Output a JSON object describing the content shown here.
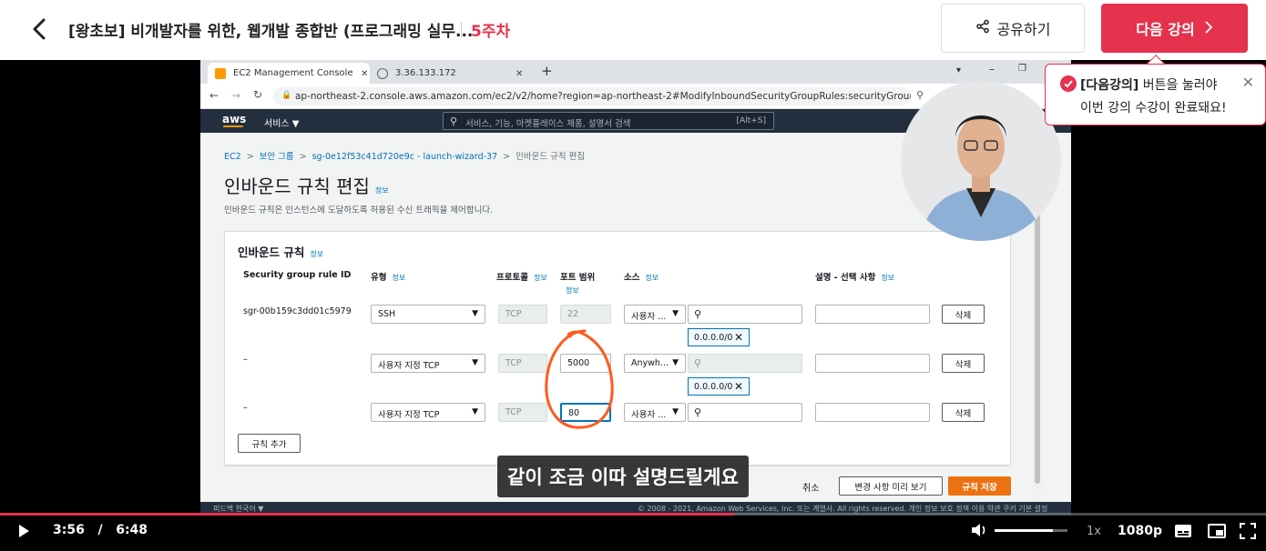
{
  "header": {
    "course_title": "[왕초보] 비개발자를 위한, 웹개발 종합반 (프로그래밍 실무...",
    "week": "5주차",
    "share_label": "공유하기",
    "next_label": "다음 강의"
  },
  "tooltip": {
    "highlight": "[다음강의]",
    "line1_rest": " 버튼을 눌러야",
    "line2": "이번 강의 수강이 완료돼요!"
  },
  "browser": {
    "tabs": [
      {
        "title": "EC2 Management Console"
      },
      {
        "title": "3.36.133.172"
      }
    ],
    "url": "ap-northeast-2.console.aws.amazon.com/ec2/v2/home?region=ap-northeast-2#ModifyInboundSecurityGroupRules:securityGroupId=sg-0e1..."
  },
  "aws": {
    "logo": "aws",
    "services": "서비스 ▼",
    "search_placeholder": "서비스, 기능, 마켓플레이스 제품, 설명서 검색",
    "search_shortcut": "[Alt+S]",
    "breadcrumb": [
      "EC2",
      "보안 그룹",
      "sg-0e12f53c41d720e9c - launch-wizard-37",
      "인바운드 규칙 편집"
    ],
    "page_title": "인바운드 규칙 편집",
    "info_label": "정보",
    "page_desc": "인바운드 규칙은 인스턴스에 도달하도록 허용된 수신 트래픽을 제어합니다.",
    "panel_title": "인바운드 규칙",
    "columns": {
      "rule_id": "Security group rule ID",
      "type": "유형",
      "protocol": "프로토콜",
      "port": "포트 범위",
      "source": "소스",
      "desc": "설명 - 선택 사항"
    },
    "rules": [
      {
        "id": "sgr-00b159c3dd01c5979",
        "type": "SSH",
        "protocol": "TCP",
        "port": "22",
        "source": "사용자 ...",
        "token": "0.0.0.0/0",
        "delete": "삭제"
      },
      {
        "id": "–",
        "type": "사용자 지정 TCP",
        "protocol": "TCP",
        "port": "5000",
        "source": "Anywh...",
        "token": "0.0.0.0/0",
        "delete": "삭제"
      },
      {
        "id": "–",
        "type": "사용자 지정 TCP",
        "protocol": "TCP",
        "port": "80",
        "source": "사용자 ...",
        "token": "",
        "delete": "삭제"
      }
    ],
    "add_rule": "규칙 추가",
    "cancel": "취소",
    "preview": "변경 사항 미리 보기",
    "save": "규칙 저장",
    "footer_left": "피드백   한국어 ▼",
    "footer_right": "© 2008 - 2021, Amazon Web Services, Inc. 또는 계열사. All rights reserved.   개인 정보 보호 정책   이용 약관   쿠키 기본 설정"
  },
  "caption": "같이 조금 이따 설명드릴게요",
  "player": {
    "current": "3:56",
    "divider": "/",
    "duration": "6:48",
    "progress": 0.58,
    "volume": 0.8,
    "speed": "1x",
    "quality": "1080p"
  },
  "colors": {
    "brand": "#e5324d",
    "aws_nav": "#232f3e",
    "aws_primary": "#ec7211",
    "annotation": "#ff5a1f"
  }
}
